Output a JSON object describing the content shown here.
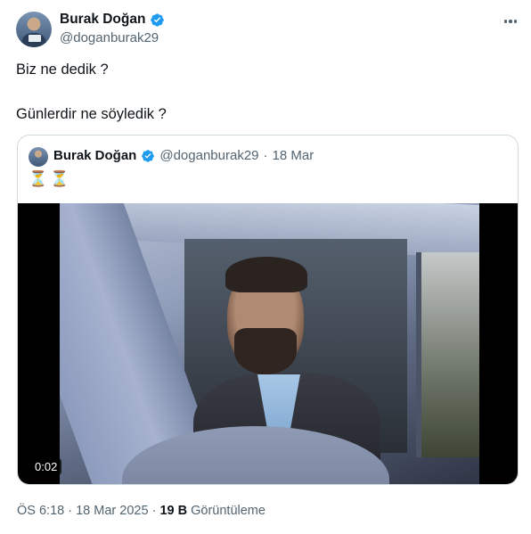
{
  "author": {
    "name": "Burak Doğan",
    "handle": "@doganburak29",
    "verified": true
  },
  "tweet": {
    "lines": [
      "Biz ne dedik ?",
      "Günlerdir ne söyledik ?"
    ]
  },
  "quoted_tweet": {
    "name": "Burak Doğan",
    "handle": "@doganburak29",
    "separator": "·",
    "date": "18 Mar",
    "text": "⏳⏳",
    "video_duration": "0:02"
  },
  "footer": {
    "time": "ÖS 6:18",
    "separator": "·",
    "date": "18 Mar 2025",
    "views_count": "19 B",
    "views_label": "Görüntüleme"
  },
  "colors": {
    "verified_blue": "#1d9bf0",
    "text_primary": "#0f1419",
    "text_secondary": "#536471",
    "border": "#cfd9de"
  },
  "icons": {
    "verified": "verified-badge-icon",
    "more": "more-horizontal-icon"
  }
}
